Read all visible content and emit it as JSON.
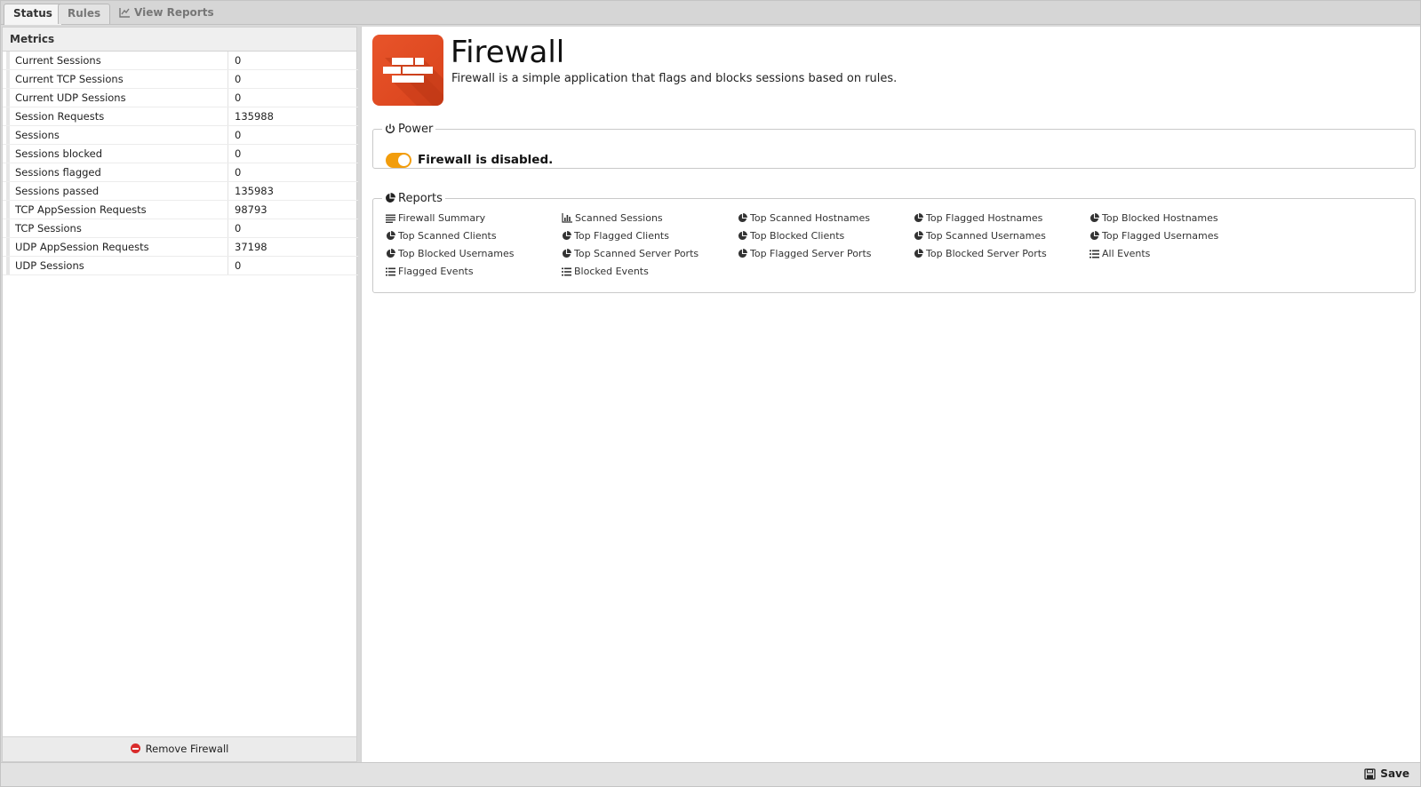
{
  "tabs": [
    {
      "label": "Status",
      "active": true
    },
    {
      "label": "Rules",
      "active": false
    },
    {
      "label": "View Reports",
      "active": false,
      "icon": "line-chart-icon"
    }
  ],
  "metrics": {
    "title": "Metrics",
    "rows": [
      {
        "name": "Current Sessions",
        "value": "0"
      },
      {
        "name": "Current TCP Sessions",
        "value": "0"
      },
      {
        "name": "Current UDP Sessions",
        "value": "0"
      },
      {
        "name": "Session Requests",
        "value": "135988"
      },
      {
        "name": "Sessions",
        "value": "0"
      },
      {
        "name": "Sessions blocked",
        "value": "0"
      },
      {
        "name": "Sessions flagged",
        "value": "0"
      },
      {
        "name": "Sessions passed",
        "value": "135983"
      },
      {
        "name": "TCP AppSession Requests",
        "value": "98793"
      },
      {
        "name": "TCP Sessions",
        "value": "0"
      },
      {
        "name": "UDP AppSession Requests",
        "value": "37198"
      },
      {
        "name": "UDP Sessions",
        "value": "0"
      }
    ],
    "remove_label": "Remove Firewall"
  },
  "app": {
    "title": "Firewall",
    "description": "Firewall is a simple application that flags and blocks sessions based on rules.",
    "icon": "firewall-brick-icon",
    "brand_color": "#e14b22"
  },
  "power": {
    "legend": "Power",
    "status": "Firewall is disabled.",
    "toggle_color": "#f29d0c"
  },
  "reports": {
    "legend": "Reports",
    "links": [
      {
        "label": "Firewall Summary",
        "icon": "text-icon"
      },
      {
        "label": "Scanned Sessions",
        "icon": "bar-chart-icon"
      },
      {
        "label": "Top Scanned Hostnames",
        "icon": "pie-chart-icon"
      },
      {
        "label": "Top Flagged Hostnames",
        "icon": "pie-chart-icon"
      },
      {
        "label": "Top Blocked Hostnames",
        "icon": "pie-chart-icon"
      },
      {
        "label": "Top Scanned Clients",
        "icon": "pie-chart-icon"
      },
      {
        "label": "Top Flagged Clients",
        "icon": "pie-chart-icon"
      },
      {
        "label": "Top Blocked Clients",
        "icon": "pie-chart-icon"
      },
      {
        "label": "Top Scanned Usernames",
        "icon": "pie-chart-icon"
      },
      {
        "label": "Top Flagged Usernames",
        "icon": "pie-chart-icon"
      },
      {
        "label": "Top Blocked Usernames",
        "icon": "pie-chart-icon"
      },
      {
        "label": "Top Scanned Server Ports",
        "icon": "pie-chart-icon"
      },
      {
        "label": "Top Flagged Server Ports",
        "icon": "pie-chart-icon"
      },
      {
        "label": "Top Blocked Server Ports",
        "icon": "pie-chart-icon"
      },
      {
        "label": "All Events",
        "icon": "list-icon"
      },
      {
        "label": "Flagged Events",
        "icon": "list-icon"
      },
      {
        "label": "Blocked Events",
        "icon": "list-icon"
      }
    ]
  },
  "footer": {
    "save_label": "Save"
  }
}
